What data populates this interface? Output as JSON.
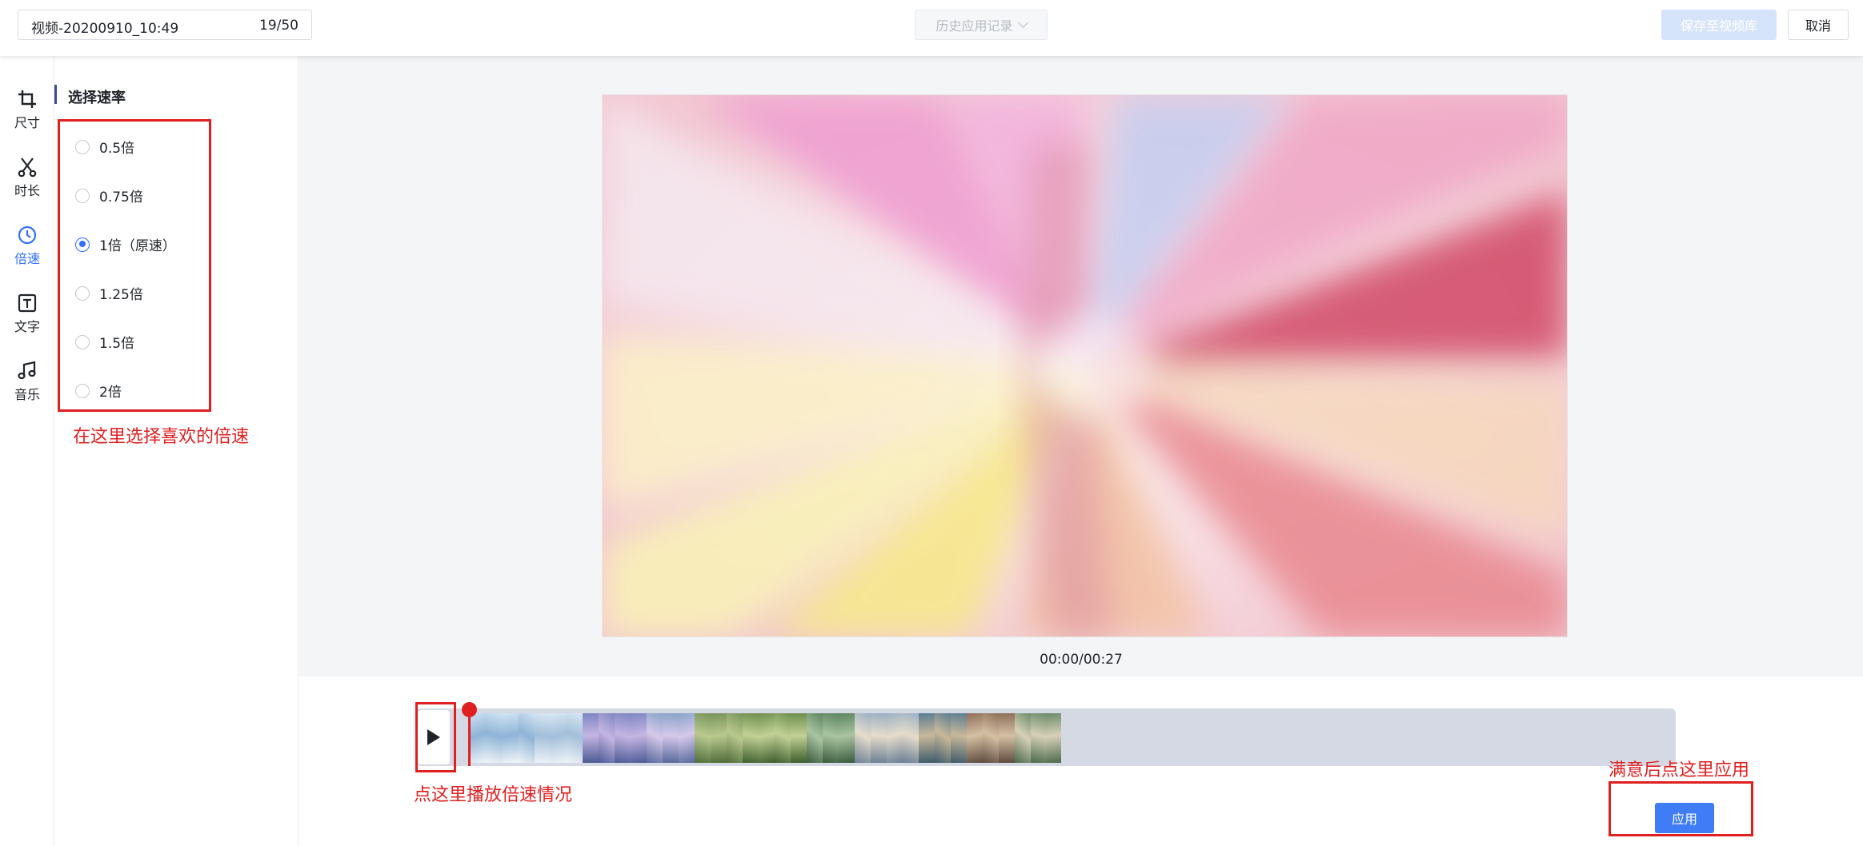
{
  "header": {
    "title_value": "视频-20200910_10:49",
    "title_count": "19/50",
    "history_label": "历史应用记录",
    "save_label": "保存至视频库",
    "cancel_label": "取消"
  },
  "nav": {
    "items": [
      {
        "label": "尺寸",
        "icon": "crop-icon"
      },
      {
        "label": "时长",
        "icon": "scissors-icon"
      },
      {
        "label": "倍速",
        "icon": "clock-icon",
        "active": true
      },
      {
        "label": "文字",
        "icon": "text-icon"
      },
      {
        "label": "音乐",
        "icon": "music-icon"
      }
    ]
  },
  "panel": {
    "title": "选择速率",
    "options": [
      {
        "label": "0.5倍",
        "checked": false
      },
      {
        "label": "0.75倍",
        "checked": false
      },
      {
        "label": "1倍（原速）",
        "checked": true
      },
      {
        "label": "1.25倍",
        "checked": false
      },
      {
        "label": "1.5倍",
        "checked": false
      },
      {
        "label": "2倍",
        "checked": false
      }
    ]
  },
  "annotations": {
    "speed_hint": "在这里选择喜欢的倍速",
    "play_hint": "点这里播放倍速情况",
    "apply_hint": "满意后点这里应用"
  },
  "player": {
    "time": "00:00/00:27"
  },
  "apply_label": "应用",
  "colors": {
    "accent": "#3370ff",
    "annotation": "#e02020",
    "track": "#d5d9e4"
  }
}
